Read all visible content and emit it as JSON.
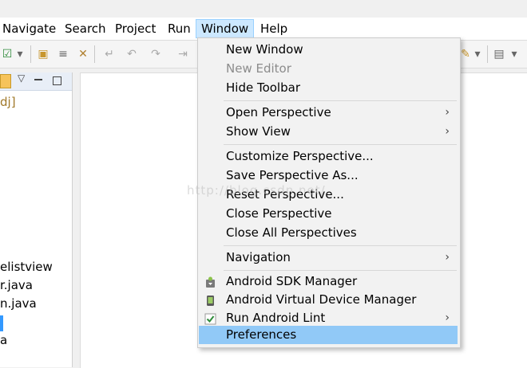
{
  "menubar": {
    "items": [
      {
        "label": "Navigate"
      },
      {
        "label": "Search"
      },
      {
        "label": "Project"
      },
      {
        "label": "Run"
      },
      {
        "label": "Window"
      },
      {
        "label": "Help"
      }
    ]
  },
  "left_panel": {
    "project_suffix": "dj]",
    "files": [
      "elistview",
      "r.java",
      "n.java",
      "",
      "a"
    ]
  },
  "window_menu": {
    "new_window": "New Window",
    "new_editor": "New Editor",
    "hide_toolbar": "Hide Toolbar",
    "open_perspective": "Open Perspective",
    "show_view": "Show View",
    "customize_perspective": "Customize Perspective...",
    "save_perspective_as": "Save Perspective As...",
    "reset_perspective": "Reset Perspective...",
    "close_perspective": "Close Perspective",
    "close_all_perspectives": "Close All Perspectives",
    "navigation": "Navigation",
    "android_sdk_manager": "Android SDK Manager",
    "android_avd_manager": "Android Virtual Device Manager",
    "run_android_lint": "Run Android Lint",
    "preferences": "Preferences",
    "submenu_arrow": "›"
  },
  "watermark": "http://blog.csdn.net/",
  "colors": {
    "menu_highlight": "#91c9f7",
    "menubar_active": "#cce8ff",
    "disabled_text": "#8c8c8c"
  }
}
